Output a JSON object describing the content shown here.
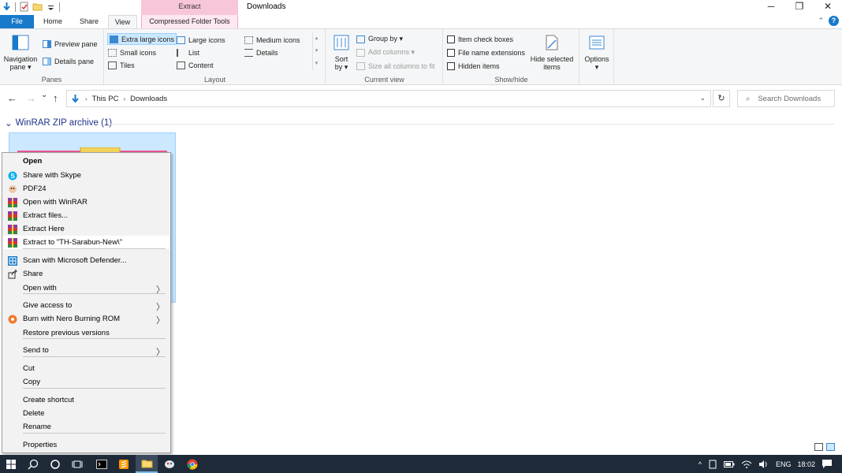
{
  "window": {
    "title": "Downloads",
    "context_tab_header": "Extract",
    "controls": {
      "minimize": "─",
      "restore": "❐",
      "close": "✕"
    }
  },
  "tabs": {
    "file": "File",
    "home": "Home",
    "share": "Share",
    "view": "View",
    "compressed_tools": "Compressed Folder Tools"
  },
  "help": {
    "collapse_glyph": "⌃",
    "help_glyph": "?"
  },
  "ribbon": {
    "panes": {
      "name": "Panes",
      "navigation_pane_line1": "Navigation",
      "navigation_pane_line2": "pane ▾",
      "preview_pane": "Preview pane",
      "details_pane": "Details pane"
    },
    "layout": {
      "name": "Layout",
      "extra_large_icons": "Extra large icons",
      "large_icons": "Large icons",
      "medium_icons": "Medium icons",
      "small_icons": "Small icons",
      "list": "List",
      "details": "Details",
      "tiles": "Tiles",
      "content": "Content",
      "scroll_up": "▴",
      "scroll_down": "▾",
      "more": "▾"
    },
    "current_view": {
      "name": "Current view",
      "sort_by_line1": "Sort",
      "sort_by_line2": "by ▾",
      "group_by": "Group by ▾",
      "add_columns": "Add columns ▾",
      "size_all_columns": "Size all columns to fit"
    },
    "show_hide": {
      "name": "Show/hide",
      "item_check_boxes": "Item check boxes",
      "file_name_extensions": "File name extensions",
      "hidden_items": "Hidden items",
      "hide_selected_line1": "Hide selected",
      "hide_selected_line2": "items"
    },
    "options": {
      "label": "Options",
      "dropdown": "▾"
    }
  },
  "address": {
    "back": "←",
    "forward": "→",
    "recent": "⌄",
    "up": "↑",
    "crumbs": [
      "This PC",
      "Downloads"
    ],
    "separator": "›",
    "dropdown": "⌄",
    "refresh": "↻",
    "search_placeholder": "Search Downloads",
    "search_icon": "⌕"
  },
  "content": {
    "group_header": "WinRAR ZIP archive (1)",
    "group_chevron": "⌄"
  },
  "context_menu": {
    "items": [
      {
        "label": "Open",
        "icon": "none",
        "bold": true
      },
      {
        "label": "Share with Skype",
        "icon": "skype-icon"
      },
      {
        "label": "PDF24",
        "icon": "pdf24-icon"
      },
      {
        "label": "Open with WinRAR",
        "icon": "winrar-icon"
      },
      {
        "label": "Extract files...",
        "icon": "winrar-icon"
      },
      {
        "label": "Extract Here",
        "icon": "winrar-icon"
      },
      {
        "label": "Extract to \"TH-Sarabun-New\\\"",
        "icon": "winrar-icon",
        "highlighted": true
      },
      {
        "label": "Scan with Microsoft Defender...",
        "icon": "defender-icon"
      },
      {
        "label": "Share",
        "icon": "share-icon"
      },
      {
        "label": "Open with",
        "icon": "none",
        "submenu": true
      },
      {
        "label": "Give access to",
        "icon": "none",
        "submenu": true
      },
      {
        "label": "Burn with Nero Burning ROM",
        "icon": "nero-icon",
        "submenu": true
      },
      {
        "label": "Restore previous versions",
        "icon": "none"
      },
      {
        "label": "Send to",
        "icon": "none",
        "submenu": true
      },
      {
        "label": "Cut",
        "icon": "none"
      },
      {
        "label": "Copy",
        "icon": "none"
      },
      {
        "label": "Create shortcut",
        "icon": "none"
      },
      {
        "label": "Delete",
        "icon": "none"
      },
      {
        "label": "Rename",
        "icon": "none"
      },
      {
        "label": "Properties",
        "icon": "none"
      }
    ],
    "submenu_glyph": "〉"
  },
  "taskbar": {
    "tray": {
      "language": "ENG",
      "time": "18:02",
      "overflow": "^"
    }
  },
  "colors": {
    "accent": "#1979ca",
    "selection": "#cce8ff",
    "selection_border": "#99d1ff",
    "context_tab": "#f7c6d9",
    "taskbar": "#1f2a38"
  }
}
